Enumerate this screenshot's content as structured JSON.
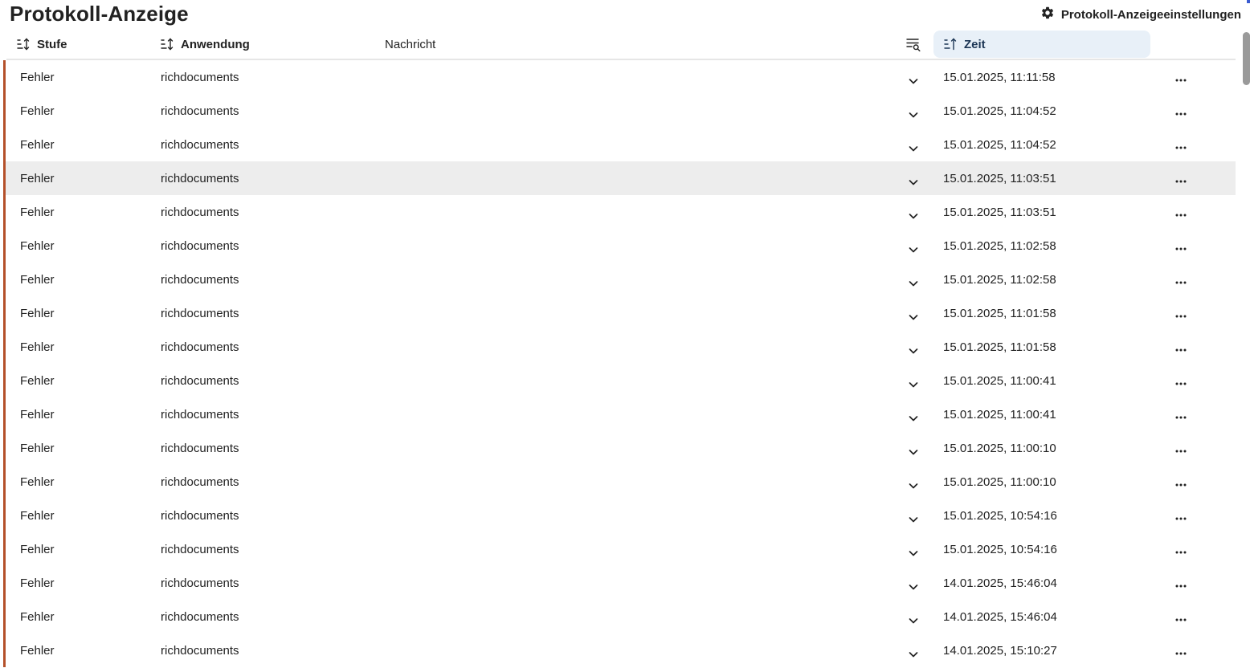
{
  "page": {
    "title": "Protokoll-Anzeige",
    "settings_label": "Protokoll-Anzeigeeinstellungen",
    "settings_icon": "gear-icon"
  },
  "table": {
    "columns": {
      "level": "Stufe",
      "app": "Anwendung",
      "message": "Nachricht",
      "time": "Zeit"
    },
    "filter_icon": "filter-search-icon",
    "sort_icon": "sort-icon",
    "level_color": "#b4502a",
    "highlight_color": "#ededed",
    "active_header_color": "#e8f0f8",
    "rows": [
      {
        "level": "Fehler",
        "app": "richdocuments",
        "time": "15.01.2025, 11:11:58"
      },
      {
        "level": "Fehler",
        "app": "richdocuments",
        "time": "15.01.2025, 11:04:52"
      },
      {
        "level": "Fehler",
        "app": "richdocuments",
        "time": "15.01.2025, 11:04:52"
      },
      {
        "level": "Fehler",
        "app": "richdocuments",
        "time": "15.01.2025, 11:03:51",
        "highlighted": true
      },
      {
        "level": "Fehler",
        "app": "richdocuments",
        "time": "15.01.2025, 11:03:51"
      },
      {
        "level": "Fehler",
        "app": "richdocuments",
        "time": "15.01.2025, 11:02:58"
      },
      {
        "level": "Fehler",
        "app": "richdocuments",
        "time": "15.01.2025, 11:02:58"
      },
      {
        "level": "Fehler",
        "app": "richdocuments",
        "time": "15.01.2025, 11:01:58"
      },
      {
        "level": "Fehler",
        "app": "richdocuments",
        "time": "15.01.2025, 11:01:58"
      },
      {
        "level": "Fehler",
        "app": "richdocuments",
        "time": "15.01.2025, 11:00:41"
      },
      {
        "level": "Fehler",
        "app": "richdocuments",
        "time": "15.01.2025, 11:00:41"
      },
      {
        "level": "Fehler",
        "app": "richdocuments",
        "time": "15.01.2025, 11:00:10"
      },
      {
        "level": "Fehler",
        "app": "richdocuments",
        "time": "15.01.2025, 11:00:10"
      },
      {
        "level": "Fehler",
        "app": "richdocuments",
        "time": "15.01.2025, 10:54:16"
      },
      {
        "level": "Fehler",
        "app": "richdocuments",
        "time": "15.01.2025, 10:54:16"
      },
      {
        "level": "Fehler",
        "app": "richdocuments",
        "time": "14.01.2025, 15:46:04"
      },
      {
        "level": "Fehler",
        "app": "richdocuments",
        "time": "14.01.2025, 15:46:04"
      },
      {
        "level": "Fehler",
        "app": "richdocuments",
        "time": "14.01.2025, 15:10:27"
      }
    ]
  }
}
